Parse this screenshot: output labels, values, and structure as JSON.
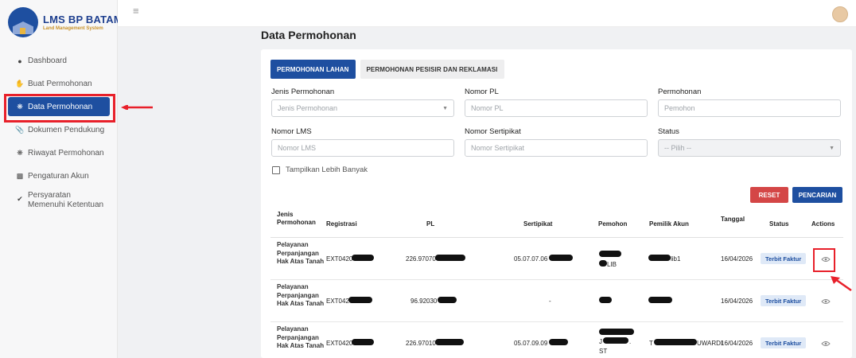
{
  "brand": {
    "title": "LMS BP BATAM",
    "subtitle": "Land Management System"
  },
  "sidebar": {
    "items": [
      {
        "label": "Dashboard",
        "icon": "dashboard-icon"
      },
      {
        "label": "Buat Permohonan",
        "icon": "hand-icon"
      },
      {
        "label": "Data Permohonan",
        "icon": "data-icon",
        "active": true
      },
      {
        "label": "Dokumen Pendukung",
        "icon": "paperclip-icon"
      },
      {
        "label": "Riwayat Permohonan",
        "icon": "history-icon"
      },
      {
        "label": "Pengaturan Akun",
        "icon": "user-settings-icon"
      },
      {
        "label": "Persyaratan Memenuhi Ketentuan",
        "icon": "check-circle-icon"
      }
    ]
  },
  "header": {
    "page_title": "Data Permohonan"
  },
  "tabs": [
    "PERMOHONAN LAHAN",
    "PERMOHONAN PESISIR DAN REKLAMASI"
  ],
  "filters": {
    "jenis": {
      "label": "Jenis Permohonan",
      "placeholder": "Jenis Permohonan"
    },
    "nomor_pl": {
      "label": "Nomor PL",
      "placeholder": "Nomor PL"
    },
    "pemohon": {
      "label": "Permohonan",
      "placeholder": "Pemohon"
    },
    "nomor_lms": {
      "label": "Nomor LMS",
      "placeholder": "Nomor LMS"
    },
    "nomor_sertipikat": {
      "label": "Nomor Sertipikat",
      "placeholder": "Nomor Sertipikat"
    },
    "status": {
      "label": "Status",
      "placeholder": "-- Pilih --"
    },
    "more": "Tampilkan Lebih Banyak"
  },
  "buttons": {
    "reset": "RESET",
    "search": "PENCARIAN"
  },
  "table": {
    "headers": [
      "Jenis Permohonan",
      "Registrasi",
      "PL",
      "Sertipikat",
      "Pemohon",
      "Pemilik Akun",
      "Tanggal",
      "Status",
      "Actions"
    ],
    "rows": [
      {
        "jenis": "Pelayanan Perpanjangan Hak Atas Tanah",
        "registrasi": "EXT0420",
        "pl": "226.97070",
        "sertipikat": "05.07.07.06",
        "pemohon": "LIB",
        "pemilik": "lib1",
        "tanggal": "16/04/2026",
        "status": "Terbit Faktur"
      },
      {
        "jenis": "Pelayanan Perpanjangan Hak Atas Tanah",
        "registrasi": "EXT042",
        "pl": "96.92030",
        "sertipikat": "-",
        "pemohon": "",
        "pemilik": "",
        "tanggal": "16/04/2026",
        "status": "Terbit Faktur"
      },
      {
        "jenis": "Pelayanan Perpanjangan Hak Atas Tanah",
        "registrasi": "EXT0420",
        "pl": "226.97010",
        "sertipikat": "05.07.09.09",
        "pemohon": "J",
        "pemohon_b": ".",
        "pemohon_c": "ST",
        "pemilik": "T",
        "pemilik_b": "UWARDI",
        "tanggal": "16/04/2026",
        "status": "Terbit Faktur"
      }
    ]
  },
  "colors": {
    "primary": "#1e4fa0",
    "danger": "#d44646",
    "annotation": "#e8202a"
  }
}
